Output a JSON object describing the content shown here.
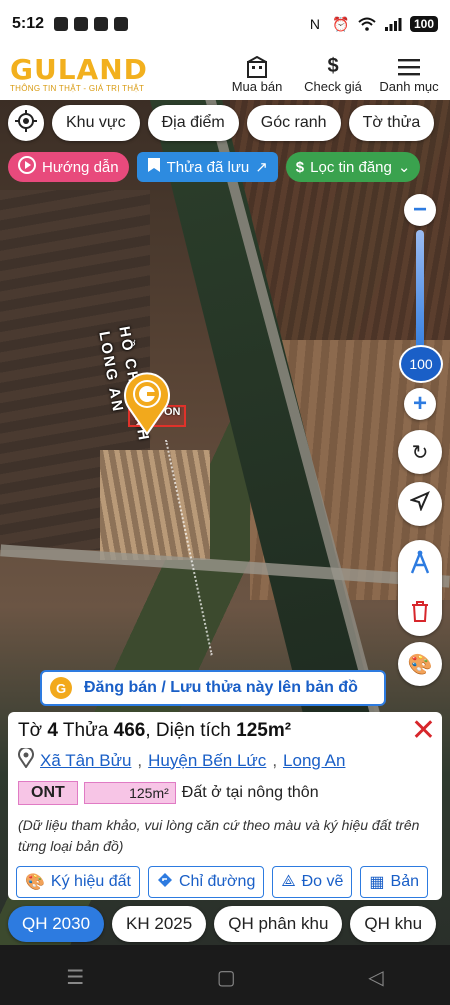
{
  "statusbar": {
    "time": "5:12",
    "battery": "100"
  },
  "header": {
    "logo": "GULAND",
    "logo_sub": "THÔNG TIN THẬT - GIÁ TRỊ THẬT",
    "actions": [
      {
        "label": "Mua bán",
        "icon": "building-icon"
      },
      {
        "label": "Check giá",
        "icon": "dollar-icon"
      },
      {
        "label": "Danh mục",
        "icon": "menu-icon"
      }
    ]
  },
  "filters": {
    "khu_vuc": "Khu vực",
    "dia_diem": "Địa điểm",
    "goc_ranh": "Góc ranh",
    "to_thua": "Tờ thửa"
  },
  "pills": {
    "huong_dan": "Hướng dẫn",
    "thua_da_luu": "Thửa đã lưu",
    "loc_tin": "Lọc tin đăng"
  },
  "map": {
    "label_hcm": "HỒ CHÍ MINH",
    "label_la": "LONG AN",
    "parcel_label": "ON",
    "zoom": "100"
  },
  "banner": "Đăng bán / Lưu thửa này lên bản đồ",
  "parcel": {
    "to_label": "Tờ",
    "to": "4",
    "thua_label": "Thửa",
    "thua": "466",
    "dt_label": "Diện tích",
    "dt": "125m²",
    "xa": "Xã Tân Bửu",
    "huyen": "Huyện Bến Lức",
    "tinh": "Long An",
    "zone_code": "ONT",
    "zone_area": "125m²",
    "zone_desc": "Đất ở tại nông thôn",
    "note": "(Dữ liệu tham khảo, vui lòng căn cứ theo màu và ký hiệu đất trên từng loại bản đồ)"
  },
  "actions": [
    {
      "label": "Ký hiệu đất"
    },
    {
      "label": "Chỉ đường"
    },
    {
      "label": "Đo vẽ"
    },
    {
      "label": "Bản"
    }
  ],
  "tabs": [
    "QH 2030",
    "KH 2025",
    "QH phân khu",
    "QH khu"
  ],
  "colors": {
    "brand": "#f2b01e",
    "accent": "#2d7be0",
    "close": "#d7262b",
    "zone": "#f7c5e6"
  }
}
